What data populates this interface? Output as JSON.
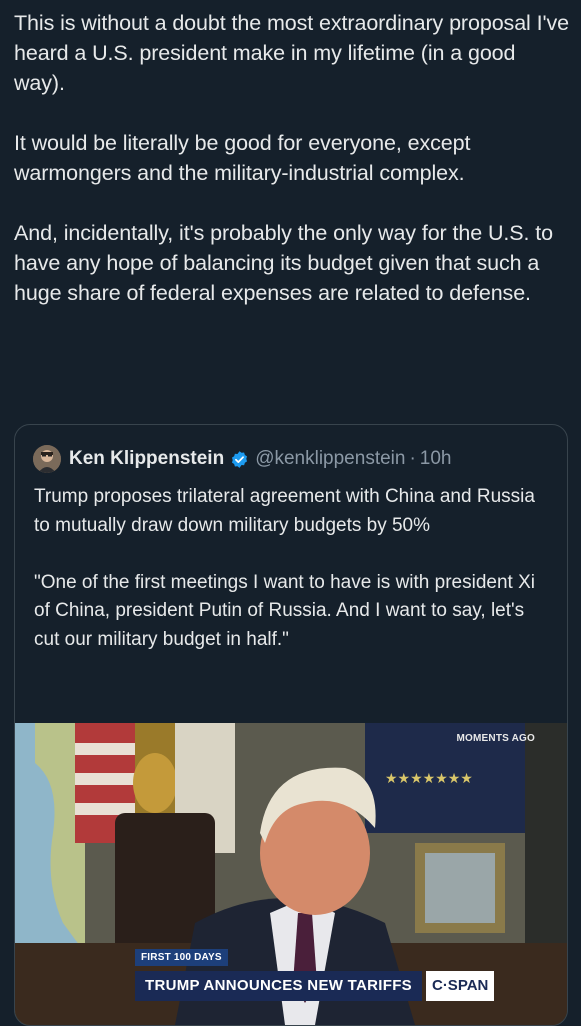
{
  "post": {
    "paragraphs": [
      "This is without a doubt the most extraordinary proposal I've heard a U.S. president make in my lifetime (in a good way).",
      "It would be literally be good for everyone, except warmongers and the military-industrial complex.",
      "And, incidentally, it's probably the only way for the U.S. to have any hope of balancing its budget given that such a huge share of federal expenses are related to defense."
    ]
  },
  "quote": {
    "author_name": "Ken Klippenstein",
    "handle": "@kenklippenstein",
    "separator": "·",
    "time": "10h",
    "paragraphs": [
      "Trump proposes trilateral agreement with China and Russia to mutually draw down military budgets by 50%",
      "\"One of the first meetings I want to have is with president Xi of China, president Putin of Russia. And I want to say, let's cut our military budget in half.\""
    ],
    "media": {
      "corner_label": "MOMENTS AGO",
      "chip_label": "FIRST 100 DAYS",
      "headline": "TRUMP ANNOUNCES NEW TARIFFS",
      "network": "C·SPAN"
    }
  },
  "colors": {
    "background": "#15202b",
    "text": "#e7e9ea",
    "secondary_text": "#8b98a5",
    "verified": "#1d9bf0",
    "border": "#38444d"
  }
}
